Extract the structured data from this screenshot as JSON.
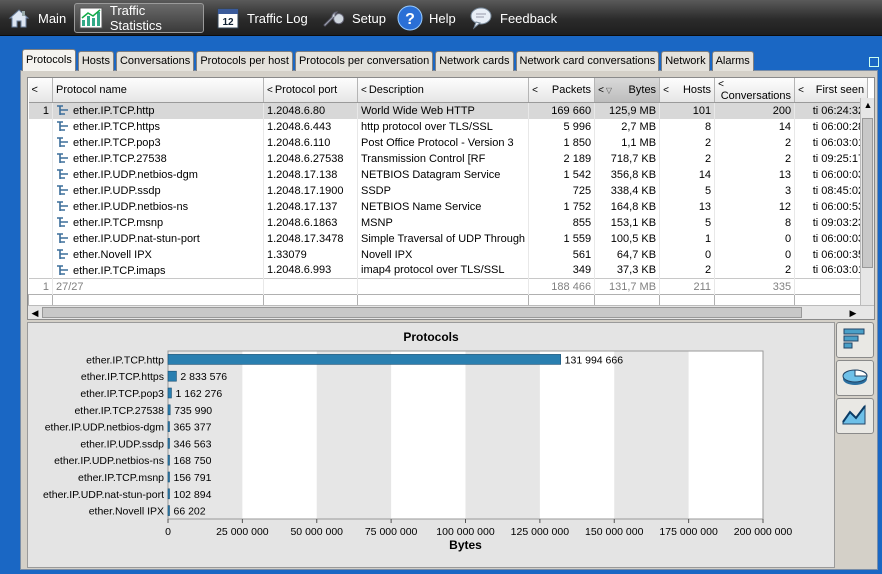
{
  "nav": {
    "items": [
      {
        "label": "Main",
        "icon": "home-icon"
      },
      {
        "label": "Traffic Statistics",
        "icon": "chart-icon",
        "active": true
      },
      {
        "label": "Traffic Log",
        "icon": "calendar-icon",
        "badge": "12"
      },
      {
        "label": "Setup",
        "icon": "wrench-icon"
      },
      {
        "label": "Help",
        "icon": "help-icon",
        "glyph": "?"
      },
      {
        "label": "Feedback",
        "icon": "speech-bubble-icon"
      }
    ]
  },
  "tabs": [
    {
      "label": "Protocols",
      "active": true
    },
    {
      "label": "Hosts"
    },
    {
      "label": "Conversations"
    },
    {
      "label": "Protocols per host"
    },
    {
      "label": "Protocols per conversation"
    },
    {
      "label": "Network cards"
    },
    {
      "label": "Network card conversations"
    },
    {
      "label": "Network"
    },
    {
      "label": "Alarms"
    }
  ],
  "table": {
    "columns": [
      {
        "label": "<",
        "key": "idx"
      },
      {
        "label": "Protocol name",
        "key": "name"
      },
      {
        "label": "Protocol port",
        "key": "port",
        "arrow": "<"
      },
      {
        "label": "Description",
        "key": "desc",
        "arrow": "<"
      },
      {
        "label": "Packets",
        "key": "packets",
        "arrow": "<"
      },
      {
        "label": "Bytes",
        "key": "bytes",
        "arrow": "<",
        "sort": "▽"
      },
      {
        "label": "Hosts",
        "key": "hosts",
        "arrow": "<"
      },
      {
        "label": "Conversations",
        "key": "conv",
        "arrow": "<"
      },
      {
        "label": "First seen",
        "key": "first",
        "arrow": "<"
      }
    ],
    "rows": [
      {
        "idx": "1",
        "name": "ether.IP.TCP.http",
        "port": "1.2048.6.80",
        "desc": "World Wide Web HTTP",
        "packets": "169 660",
        "bytes": "125,9 MB",
        "hosts": "101",
        "conv": "200",
        "first": "ti 06:24:32"
      },
      {
        "idx": "",
        "name": "ether.IP.TCP.https",
        "port": "1.2048.6.443",
        "desc": "http protocol over TLS/SSL",
        "packets": "5 996",
        "bytes": "2,7 MB",
        "hosts": "8",
        "conv": "14",
        "first": "ti 06:00:28"
      },
      {
        "idx": "",
        "name": "ether.IP.TCP.pop3",
        "port": "1.2048.6.110",
        "desc": "Post Office Protocol - Version 3",
        "packets": "1 850",
        "bytes": "1,1 MB",
        "hosts": "2",
        "conv": "2",
        "first": "ti 06:03:01"
      },
      {
        "idx": "",
        "name": "ether.IP.TCP.27538",
        "port": "1.2048.6.27538",
        "desc": "Transmission Control             [RF",
        "packets": "2 189",
        "bytes": "718,7 KB",
        "hosts": "2",
        "conv": "2",
        "first": "ti 09:25:17"
      },
      {
        "idx": "",
        "name": "ether.IP.UDP.netbios-dgm",
        "port": "1.2048.17.138",
        "desc": "NETBIOS Datagram Service",
        "packets": "1 542",
        "bytes": "356,8 KB",
        "hosts": "14",
        "conv": "13",
        "first": "ti 06:00:03"
      },
      {
        "idx": "",
        "name": "ether.IP.UDP.ssdp",
        "port": "1.2048.17.1900",
        "desc": "SSDP",
        "packets": "725",
        "bytes": "338,4 KB",
        "hosts": "5",
        "conv": "3",
        "first": "ti 08:45:02"
      },
      {
        "idx": "",
        "name": "ether.IP.UDP.netbios-ns",
        "port": "1.2048.17.137",
        "desc": "NETBIOS Name Service",
        "packets": "1 752",
        "bytes": "164,8 KB",
        "hosts": "13",
        "conv": "12",
        "first": "ti 06:00:53"
      },
      {
        "idx": "",
        "name": "ether.IP.TCP.msnp",
        "port": "1.2048.6.1863",
        "desc": "MSNP",
        "packets": "855",
        "bytes": "153,1 KB",
        "hosts": "5",
        "conv": "8",
        "first": "ti 09:03:23"
      },
      {
        "idx": "",
        "name": "ether.IP.UDP.nat-stun-port",
        "port": "1.2048.17.3478",
        "desc": "Simple Traversal of UDP Through",
        "packets": "1 559",
        "bytes": "100,5 KB",
        "hosts": "1",
        "conv": "0",
        "first": "ti 06:00:03"
      },
      {
        "idx": "",
        "name": "ether.Novell IPX",
        "port": "1.33079",
        "desc": "Novell IPX",
        "packets": "561",
        "bytes": "64,7 KB",
        "hosts": "0",
        "conv": "0",
        "first": "ti 06:00:35"
      },
      {
        "idx": "",
        "name": "ether.IP.TCP.imaps",
        "port": "1.2048.6.993",
        "desc": "imap4 protocol over TLS/SSL",
        "packets": "349",
        "bytes": "37,3 KB",
        "hosts": "2",
        "conv": "2",
        "first": "ti 06:03:01"
      }
    ],
    "summary": {
      "idx": "1",
      "name": "27/27",
      "port": "",
      "desc": "",
      "packets": "188 466",
      "bytes": "131,7 MB",
      "hosts": "211",
      "conv": "335",
      "first": ""
    }
  },
  "chart_data": {
    "type": "bar",
    "orientation": "horizontal",
    "title": "Protocols",
    "xlabel": "Bytes",
    "ylabel": "",
    "xlim": [
      0,
      200000000
    ],
    "xticks": [
      0,
      25000000,
      50000000,
      75000000,
      100000000,
      125000000,
      150000000,
      175000000,
      200000000
    ],
    "xtick_labels": [
      "0",
      "25 000 000",
      "50 000 000",
      "75 000 000",
      "100 000 000",
      "125 000 000",
      "150 000 000",
      "175 000 000",
      "200 000 000"
    ],
    "categories": [
      "ether.IP.TCP.http",
      "ether.IP.TCP.https",
      "ether.IP.TCP.pop3",
      "ether.IP.TCP.27538",
      "ether.IP.UDP.netbios-dgm",
      "ether.IP.UDP.ssdp",
      "ether.IP.UDP.netbios-ns",
      "ether.IP.TCP.msnp",
      "ether.IP.UDP.nat-stun-port",
      "ether.Novell IPX"
    ],
    "values": [
      131994666,
      2833576,
      1162276,
      735990,
      365377,
      346563,
      168750,
      156791,
      102894,
      66202
    ],
    "value_labels": [
      "131 994 666",
      "2 833 576",
      "1 162 276",
      "735 990",
      "365 377",
      "346 563",
      "168 750",
      "156 791",
      "102 894",
      "66 202"
    ],
    "bar_color": "#2a7fb0",
    "grid": "alternating bands"
  },
  "side_tools": [
    {
      "icon": "bar-chart-tool-icon"
    },
    {
      "icon": "pie-chart-tool-icon"
    },
    {
      "icon": "line-chart-tool-icon"
    }
  ]
}
